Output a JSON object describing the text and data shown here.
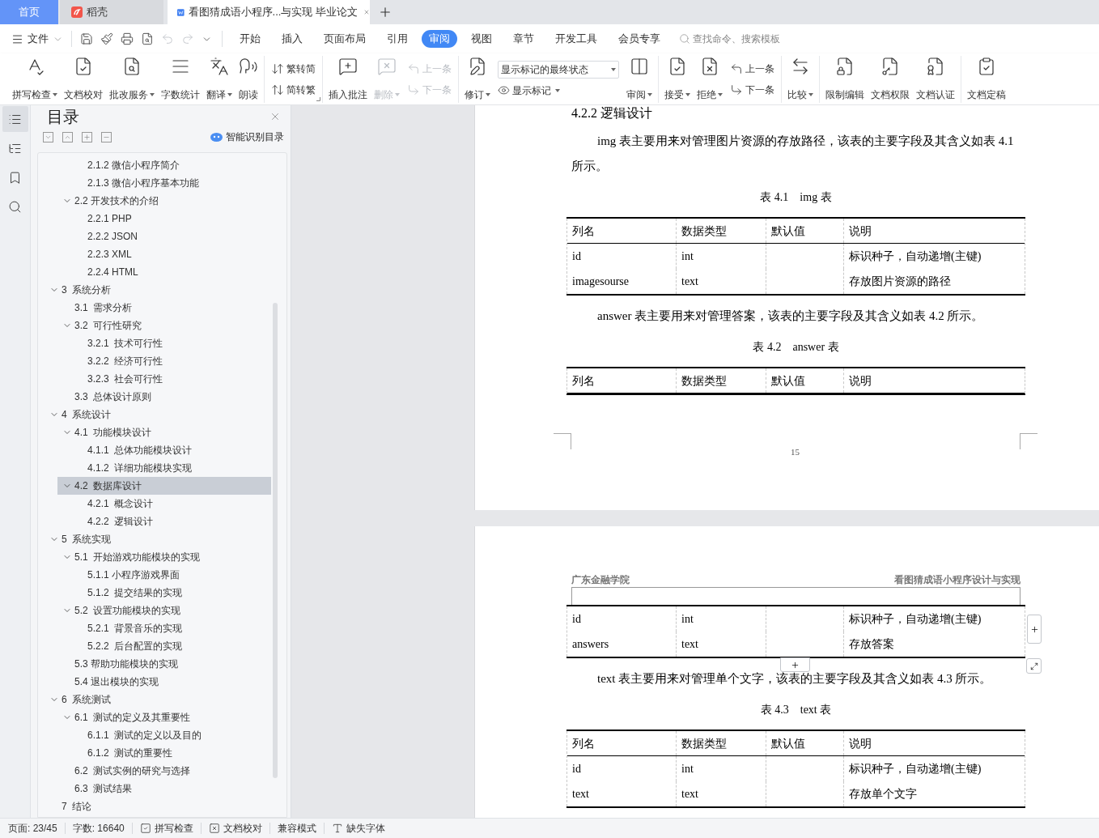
{
  "tabs": [
    {
      "kind": "home",
      "label": "首页",
      "selected": false
    },
    {
      "kind": "app",
      "label": "稻壳",
      "selected": false
    },
    {
      "kind": "doc",
      "label": "看图猜成语小程序...与实现 毕业论文",
      "selected": true
    }
  ],
  "menu": {
    "file": "文件",
    "quick_access": [
      {
        "disabled": false
      },
      {
        "disabled": false
      },
      {
        "disabled": false
      },
      {
        "disabled": false
      },
      {
        "disabled": true
      },
      {
        "disabled": true
      },
      {
        "disabled": false
      }
    ],
    "ribbon_tabs": [
      {
        "label": "开始",
        "selected": false
      },
      {
        "label": "插入",
        "selected": false
      },
      {
        "label": "页面布局",
        "selected": false
      },
      {
        "label": "引用",
        "selected": false
      },
      {
        "label": "审阅",
        "selected": true
      },
      {
        "label": "视图",
        "selected": false
      },
      {
        "label": "章节",
        "selected": false
      },
      {
        "label": "开发工具",
        "selected": false
      },
      {
        "label": "会员专享",
        "selected": false
      }
    ],
    "search": {
      "placeholder": "查找命令、搜索模板"
    }
  },
  "ribbon": [
    {
      "items": [
        {
          "kind": "large",
          "label": "拼写检查",
          "dropdown": true,
          "disabled": false
        },
        {
          "kind": "large",
          "label": "文档校对",
          "dropdown": false,
          "disabled": false
        },
        {
          "kind": "large",
          "label": "批改服务",
          "dropdown": true,
          "disabled": false
        },
        {
          "kind": "large",
          "label": "字数统计",
          "dropdown": false,
          "disabled": false
        },
        {
          "kind": "large",
          "label": "翻译",
          "dropdown": true,
          "disabled": false
        },
        {
          "kind": "large",
          "label": "朗读",
          "dropdown": false,
          "disabled": false
        }
      ]
    },
    {
      "items": [
        {
          "kind": "pair",
          "items": [
            {
              "label": "繁转简",
              "disabled": false
            },
            {
              "label": "简转繁",
              "disabled": false
            }
          ]
        }
      ]
    },
    {
      "items": [
        {
          "kind": "large",
          "label": "插入批注",
          "dropdown": false,
          "disabled": false
        },
        {
          "kind": "large",
          "label": "删除",
          "dropdown": true,
          "disabled": true
        },
        {
          "kind": "pair",
          "items": [
            {
              "label": "上一条",
              "disabled": true
            },
            {
              "label": "下一条",
              "disabled": true
            }
          ]
        }
      ]
    },
    {
      "items": [
        {
          "kind": "large",
          "label": "修订",
          "dropdown": true,
          "disabled": false
        },
        {
          "kind": "select",
          "value": "显示标记的最终状态",
          "option": {
            "label": "显示标记",
            "dropdown": true
          }
        },
        {
          "kind": "large",
          "label": "审阅",
          "dropdown": true,
          "disabled": false
        }
      ]
    },
    {
      "items": [
        {
          "kind": "large",
          "label": "接受",
          "dropdown": true,
          "disabled": false
        },
        {
          "kind": "large",
          "label": "拒绝",
          "dropdown": true,
          "disabled": false
        },
        {
          "kind": "pair",
          "items": [
            {
              "label": "上一条",
              "disabled": false
            },
            {
              "label": "下一条",
              "disabled": false
            }
          ]
        }
      ]
    },
    {
      "items": [
        {
          "kind": "large",
          "label": "比较",
          "dropdown": true,
          "disabled": false
        }
      ]
    },
    {
      "items": [
        {
          "kind": "large",
          "label": "限制编辑",
          "dropdown": false,
          "disabled": false
        },
        {
          "kind": "large",
          "label": "文档权限",
          "dropdown": false,
          "disabled": false
        },
        {
          "kind": "large",
          "label": "文档认证",
          "dropdown": false,
          "disabled": false
        }
      ]
    },
    {
      "items": [
        {
          "kind": "large",
          "label": "文档定稿",
          "dropdown": false,
          "disabled": false
        }
      ]
    }
  ],
  "side_nav": [
    {
      "selected": true
    },
    {
      "selected": false
    },
    {
      "selected": false
    },
    {
      "selected": false
    }
  ],
  "toc_panel": {
    "title": "目录",
    "smart_link": "智能识别目录",
    "toc": [
      {
        "children": [
          {
            "children": [
              {
                "label": "2.1.2 微信小程序简介",
                "selected": false
              },
              {
                "label": "2.1.3 微信小程序基本功能",
                "selected": false
              }
            ]
          },
          {
            "label": "2.2 开发技术的介绍",
            "expanded": true,
            "selected": false,
            "children": [
              {
                "label": "2.2.1 PHP",
                "selected": false
              },
              {
                "label": "2.2.2 JSON",
                "selected": false
              },
              {
                "label": "2.2.3 XML",
                "selected": false
              },
              {
                "label": "2.2.4 HTML",
                "selected": false
              }
            ]
          }
        ]
      },
      {
        "label": "3  系统分析",
        "expanded": true,
        "selected": false,
        "children": [
          {
            "label": "3.1  需求分析",
            "selected": false
          },
          {
            "label": "3.2  可行性研究",
            "expanded": true,
            "selected": false,
            "children": [
              {
                "label": "3.2.1  技术可行性",
                "selected": false
              },
              {
                "label": "3.2.2  经济可行性",
                "selected": false
              },
              {
                "label": "3.2.3  社会可行性",
                "selected": false
              }
            ]
          },
          {
            "label": "3.3  总体设计原则",
            "selected": false
          }
        ]
      },
      {
        "label": "4  系统设计",
        "expanded": true,
        "selected": false,
        "children": [
          {
            "label": "4.1  功能模块设计",
            "expanded": true,
            "selected": false,
            "children": [
              {
                "label": "4.1.1  总体功能模块设计",
                "selected": false
              },
              {
                "label": "4.1.2  详细功能模块实现",
                "selected": false
              }
            ]
          },
          {
            "label": "4.2  数据库设计",
            "expanded": true,
            "selected": true,
            "children": [
              {
                "label": "4.2.1  概念设计",
                "selected": false
              },
              {
                "label": "4.2.2  逻辑设计",
                "selected": false
              }
            ]
          }
        ]
      },
      {
        "label": "5  系统实现",
        "expanded": true,
        "selected": false,
        "children": [
          {
            "label": "5.1  开始游戏功能模块的实现",
            "expanded": true,
            "selected": false,
            "children": [
              {
                "label": "5.1.1 小程序游戏界面",
                "selected": false
              },
              {
                "label": "5.1.2  提交结果的实现",
                "selected": false
              }
            ]
          },
          {
            "label": "5.2  设置功能模块的实现",
            "expanded": true,
            "selected": false,
            "children": [
              {
                "label": "5.2.1  背景音乐的实现",
                "selected": false
              },
              {
                "label": "5.2.2  后台配置的实现",
                "selected": false
              }
            ]
          },
          {
            "label": "5.3 帮助功能模块的实现",
            "selected": false
          },
          {
            "label": "5.4 退出模块的实现",
            "selected": false
          }
        ]
      },
      {
        "label": "6  系统测试",
        "expanded": true,
        "selected": false,
        "children": [
          {
            "label": "6.1  测试的定义及其重要性",
            "expanded": true,
            "selected": false,
            "children": [
              {
                "label": "6.1.1  测试的定义以及目的",
                "selected": false
              },
              {
                "label": "6.1.2  测试的重要性",
                "selected": false
              }
            ]
          },
          {
            "label": "6.2  测试实例的研究与选择",
            "selected": false
          },
          {
            "label": "6.3  测试结果",
            "selected": false
          }
        ]
      },
      {
        "label": "7  结论",
        "selected": false
      }
    ]
  },
  "document": {
    "pages": [
      {
        "blocks": [
          {
            "kind": "heading",
            "text": "4.2.2  逻辑设计"
          },
          {
            "kind": "paragraph",
            "text": "img 表主要用来对管理图片资源的存放路径，该表的主要字段及其含义如表 4.1 所示。"
          },
          {
            "kind": "caption",
            "text": "表 4.1　img 表"
          },
          {
            "kind": "table",
            "columns": [
              "列名",
              "数据类型",
              "默认值",
              "说明"
            ],
            "rows": [
              {
                "name": "id",
                "type": "int",
                "description": "标识种子，自动递增(主键)"
              },
              {
                "name": "imagesourse",
                "type": "text",
                "description": "存放图片资源的路径"
              }
            ]
          },
          {
            "kind": "paragraph",
            "text": "answer 表主要用来对管理答案，该表的主要字段及其含义如表 4.2 所示。"
          },
          {
            "kind": "caption",
            "text": "表 4.2　answer 表"
          },
          {
            "kind": "table",
            "columns": [
              "列名",
              "数据类型",
              "默认值",
              "说明"
            ]
          }
        ],
        "page_number": "15"
      },
      {
        "header_left": "广东金融学院",
        "header_right": "看图猜成语小程序设计与实现",
        "blocks": [
          {
            "kind": "table",
            "continued": true,
            "rows": [
              {
                "name": "id",
                "type": "int",
                "description": "标识种子，自动递增(主键)"
              },
              {
                "name": "answers",
                "type": "text",
                "description": "存放答案"
              }
            ]
          },
          {
            "kind": "paragraph",
            "text": "text 表主要用来对管理单个文字，该表的主要字段及其含义如表 4.3 所示。"
          },
          {
            "kind": "caption",
            "text": "表 4.3　text 表"
          },
          {
            "kind": "table",
            "columns": [
              "列名",
              "数据类型",
              "默认值",
              "说明"
            ],
            "rows": [
              {
                "name": "id",
                "type": "int",
                "description": "标识种子，自动递增(主键)"
              },
              {
                "name": "text",
                "type": "text",
                "description": "存放单个文字"
              }
            ]
          }
        ]
      }
    ]
  },
  "status_bar": [
    {
      "kind": "plain",
      "label": "页面: 23/45"
    },
    {
      "kind": "plain",
      "label": "字数: 16640"
    },
    {
      "kind": "spell",
      "label": "拼写检查"
    },
    {
      "kind": "proof",
      "label": "文档校对"
    },
    {
      "kind": "plain",
      "label": "兼容模式"
    },
    {
      "kind": "font",
      "label": "缺失字体"
    }
  ]
}
